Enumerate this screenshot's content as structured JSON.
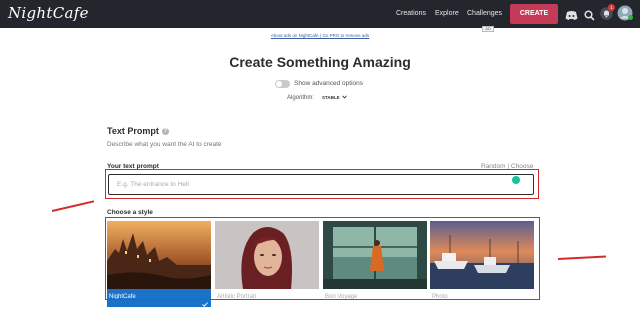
{
  "header": {
    "logo": "NightCafe",
    "nav": [
      "Creations",
      "Explore",
      "Challenges"
    ],
    "create_label": "CREATE",
    "notification_count": "1",
    "colors": {
      "bar": "#23262d",
      "create": "#c43b57"
    }
  },
  "ads": {
    "line": "About ads on NightCafe | Go PRO to remove ads",
    "tag": "AD"
  },
  "page": {
    "title": "Create Something Amazing",
    "advanced_label": "Show advanced options",
    "algorithm_label": "Algorithm:",
    "algorithm_value": "STABLE"
  },
  "text_prompt": {
    "section_title": "Text Prompt",
    "description": "Describe what you want the AI to create",
    "field_label": "Your text prompt",
    "random_label": "Random",
    "separator": "|",
    "choose_label": "Choose",
    "placeholder": "E.g. The entrance to Hell"
  },
  "styles": {
    "title": "Choose a style",
    "items": [
      {
        "name": "NightCafe",
        "selected": true
      },
      {
        "name": "Artistic Portrait",
        "selected": false
      },
      {
        "name": "Bon Voyage",
        "selected": false
      },
      {
        "name": "Photo",
        "selected": false
      }
    ]
  },
  "annotations": {
    "color": "#d22b2b"
  }
}
